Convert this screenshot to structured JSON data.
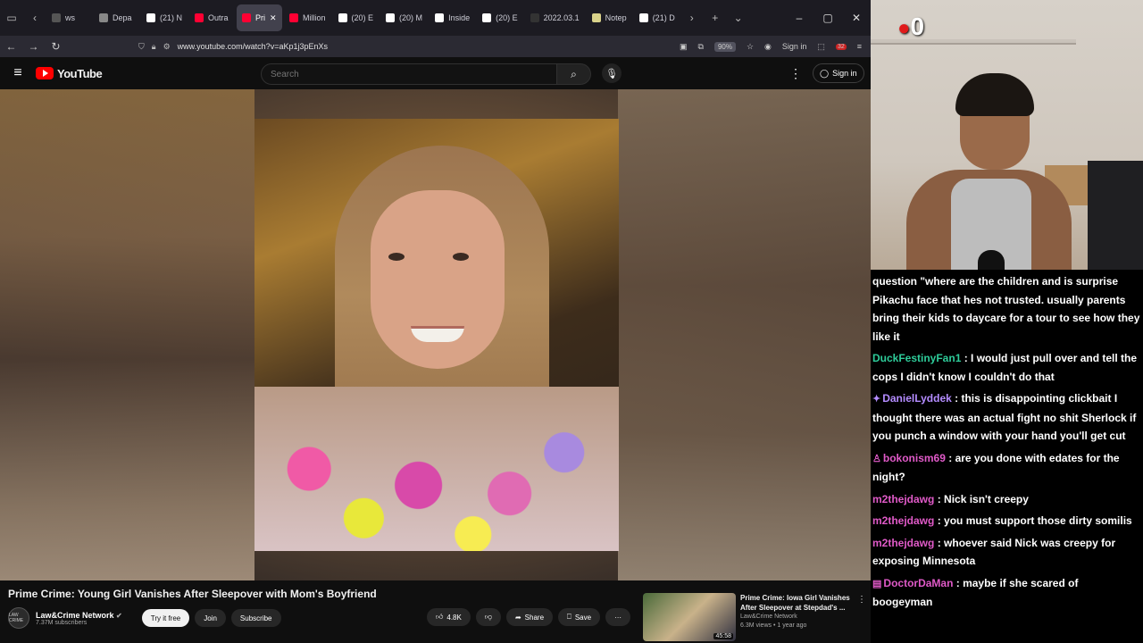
{
  "browser": {
    "tabs": [
      {
        "label": "ws",
        "fav_color": "#555555"
      },
      {
        "label": "Depa",
        "fav_color": "#888888"
      },
      {
        "label": "(21) N",
        "fav_color": "#ffffff"
      },
      {
        "label": "Outra",
        "fav_color": "#ff0033"
      },
      {
        "label": "Pri",
        "fav_color": "#ff0033"
      },
      {
        "label": "Million",
        "fav_color": "#ff0033"
      },
      {
        "label": "(20) E",
        "fav_color": "#ffffff"
      },
      {
        "label": "(20) M",
        "fav_color": "#ffffff"
      },
      {
        "label": "Inside",
        "fav_color": "#ffffff"
      },
      {
        "label": "(20) E",
        "fav_color": "#ffffff"
      },
      {
        "label": "2022.03.1",
        "fav_color": "#333333"
      },
      {
        "label": "Notep",
        "fav_color": "#d9d28a"
      },
      {
        "label": "(21) D",
        "fav_color": "#ffffff"
      }
    ],
    "url": "www.youtube.com/watch?v=aKp1j3pEnXs",
    "zoom": "90%",
    "sign_in": "Sign in",
    "ext_badge": "32"
  },
  "youtube": {
    "logo_text": "YouTube",
    "search_placeholder": "Search",
    "sign_in": "Sign in",
    "video_title": "Prime Crime: Young Girl Vanishes After Sleepover with Mom's Boyfriend",
    "channel_name": "Law&Crime Network",
    "channel_avatar_text": "LAW CRIME",
    "subscribers": "7.37M subscribers",
    "try_it_free": "Try it free",
    "join": "Join",
    "subscribe": "Subscribe",
    "likes": "4.8K",
    "share": "Share",
    "save": "Save",
    "recommended": {
      "title": "Prime Crime: Iowa Girl Vanishes After Sleepover at Stepdad's ...",
      "channel": "Law&Crime Network",
      "meta": "6.3M views • 1 year ago",
      "duration": "45:58"
    }
  },
  "stream": {
    "counter": "0"
  },
  "chat": [
    {
      "user": "",
      "user_color": "#ffffff",
      "badge": "",
      "text": "question \"where are the children and is surprise Pikachu face that hes not trusted. usually parents bring their kids to daycare for a tour to see how they like it"
    },
    {
      "user": "DuckFestinyFan1",
      "user_color": "#2ecc9a",
      "badge": "",
      "text": " : I would just pull over and tell the cops I didn't know I couldn't do that"
    },
    {
      "user": "DanielLyddek",
      "user_color": "#b48cff",
      "badge": "✦",
      "text": " : this is disappointing clickbait I thought there was an actual fight no shit Sherlock if you punch a window with your hand you'll get cut"
    },
    {
      "user": "bokonism69",
      "user_color": "#e05ac8",
      "badge": "♙",
      "text": " : are you done with edates for the night?"
    },
    {
      "user": "m2thejdawg",
      "user_color": "#e05ac8",
      "badge": "",
      "text": " : Nick isn't creepy"
    },
    {
      "user": "m2thejdawg",
      "user_color": "#e05ac8",
      "badge": "",
      "text": " : you must support those dirty somilis"
    },
    {
      "user": "m2thejdawg",
      "user_color": "#e05ac8",
      "badge": "",
      "text": " : whoever said Nick was creepy for exposing Minnesota"
    },
    {
      "user": "DoctorDaMan",
      "user_color": "#e05ac8",
      "badge": "▤",
      "text": " : maybe if she scared of boogeyman"
    }
  ]
}
